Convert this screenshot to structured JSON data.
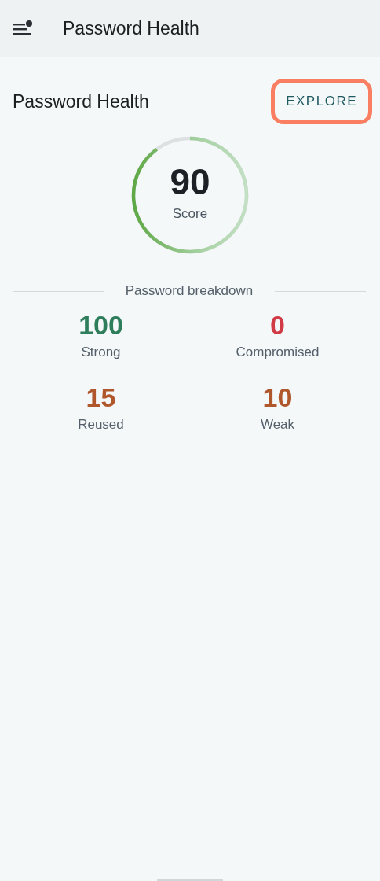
{
  "app_bar": {
    "title": "Password Health",
    "menu_badge": true
  },
  "header": {
    "title": "Password Health",
    "button": {
      "label": "EXPLORE",
      "highlighted": true
    }
  },
  "score": {
    "value": "90",
    "label": "Score"
  },
  "breakdown": {
    "title": "Password breakdown",
    "stats": [
      {
        "value": "100",
        "label": "Strong",
        "color": "#2e7d5b"
      },
      {
        "value": "0",
        "label": "Compromised",
        "color": "#d13b45"
      },
      {
        "value": "15",
        "label": "Reused",
        "color": "#b0582b"
      },
      {
        "value": "10",
        "label": "Weak",
        "color": "#b0582b"
      }
    ]
  }
}
